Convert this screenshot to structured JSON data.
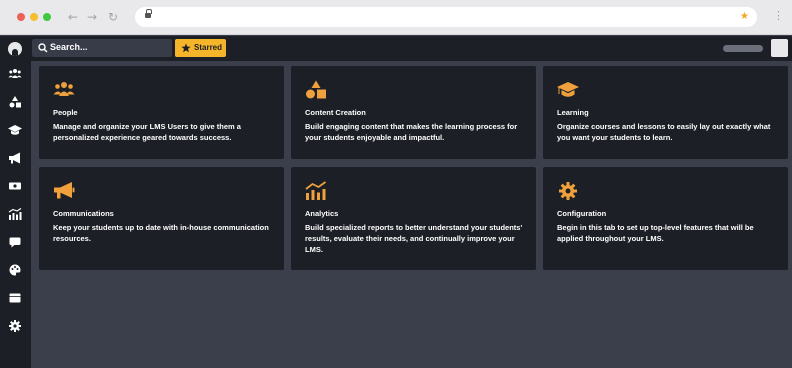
{
  "browser": {
    "back_icon": "←",
    "forward_icon": "→",
    "reload_icon": "↻",
    "bookmark_icon": "★",
    "menu_icon": "⋮"
  },
  "sidebar": {
    "items": [
      {
        "icon": "users-icon"
      },
      {
        "icon": "shapes-icon"
      },
      {
        "icon": "graduation-cap-icon"
      },
      {
        "icon": "megaphone-icon"
      },
      {
        "icon": "ticket-icon"
      },
      {
        "icon": "analytics-icon"
      },
      {
        "icon": "comment-icon"
      },
      {
        "icon": "palette-icon"
      },
      {
        "icon": "window-icon"
      },
      {
        "icon": "gear-icon"
      }
    ]
  },
  "topbar": {
    "search_label": "Search...",
    "starred_label": "Starred"
  },
  "cards": [
    {
      "title": "People",
      "description": "Manage and organize your LMS Users to give them a personalized experience geared towards success.",
      "icon": "users-icon"
    },
    {
      "title": "Content Creation",
      "description": "Build engaging content that makes the learning process for your students enjoyable and impactful.",
      "icon": "shapes-icon"
    },
    {
      "title": "Learning",
      "description": "Organize courses and lessons to easily lay out exactly what you want your students to learn.",
      "icon": "graduation-cap-icon"
    },
    {
      "title": "Communications",
      "description": "Keep your students up to date with in-house communication resources.",
      "icon": "megaphone-icon"
    },
    {
      "title": "Analytics",
      "description": "Build specialized reports to better understand your students' results, evaluate their needs, and continually improve your LMS.",
      "icon": "analytics-icon"
    },
    {
      "title": "Configuration",
      "description": "Begin in this tab to set up top-level features that will be applied throughout your LMS.",
      "icon": "gear-icon"
    }
  ],
  "colors": {
    "accent": "#f0a03c",
    "panel": "#1c1f26",
    "background": "#3a3f4b",
    "starred": "#f5b52b"
  }
}
